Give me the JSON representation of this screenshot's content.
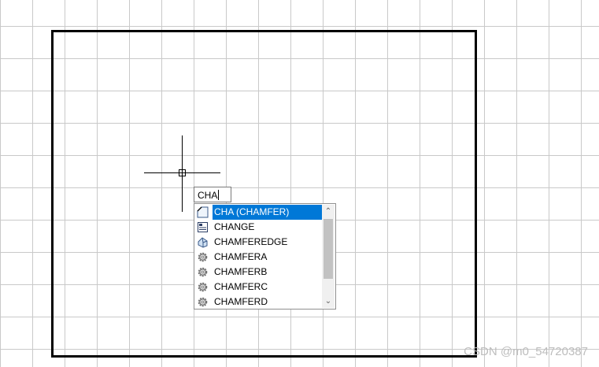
{
  "command_line": {
    "input_value": "CHA"
  },
  "autocomplete": {
    "items": [
      {
        "label": "CHA (CHAMFER)",
        "icon": "chamfer-icon",
        "selected": true
      },
      {
        "label": "CHANGE",
        "icon": "change-properties-icon",
        "selected": false
      },
      {
        "label": "CHAMFEREDGE",
        "icon": "chamfer-edge-icon",
        "selected": false
      },
      {
        "label": "CHAMFERA",
        "icon": "system-variable-gear-icon",
        "selected": false
      },
      {
        "label": "CHAMFERB",
        "icon": "system-variable-gear-icon",
        "selected": false
      },
      {
        "label": "CHAMFERC",
        "icon": "system-variable-gear-icon",
        "selected": false
      },
      {
        "label": "CHAMFERD",
        "icon": "system-variable-gear-icon",
        "selected": false
      }
    ]
  },
  "colors": {
    "selection": "#0078d7",
    "grid": "#c9c9c9",
    "border": "#000000"
  },
  "watermark": "CSDN @m0_54720387"
}
